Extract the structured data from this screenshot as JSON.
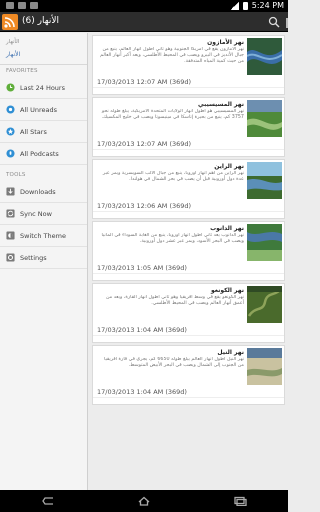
{
  "status_bar": {
    "time": "5:24 PM"
  },
  "action_bar": {
    "title": "الأنهار (6)"
  },
  "sidebar": {
    "feed_section": "الأنهار",
    "feed_label": "الأنهار",
    "favorites_header": "FAVORITES",
    "favorites": [
      {
        "label": "Last 24 Hours",
        "icon": "clock-icon"
      },
      {
        "label": "All Unreads",
        "icon": "unread-icon"
      },
      {
        "label": "All Stars",
        "icon": "star-icon"
      },
      {
        "label": "All Podcasts",
        "icon": "podcast-icon"
      }
    ],
    "tools_header": "TOOLS",
    "tools": [
      {
        "label": "Downloads",
        "icon": "download-icon"
      },
      {
        "label": "Sync Now",
        "icon": "sync-icon"
      },
      {
        "label": "Switch Theme",
        "icon": "theme-icon"
      },
      {
        "label": "Settings",
        "icon": "settings-icon"
      }
    ]
  },
  "articles": [
    {
      "title": "نهر الأمازون",
      "body": "نهر الأمازون يقع في أمريكا الجنوبية وهو ثاني أطول أنهار العالم، ينبع من جبال الأنديز في البيرو ويصب في المحيط الأطلسي، ويعد أكبر أنهار العالم من حيث كمية المياه المتدفقة.",
      "date": "17/03/2013 12:07 AM (369d)",
      "thumb_colors": [
        "#3a6ea8",
        "#7fb0d8",
        "#2f5a3b"
      ]
    },
    {
      "title": "نهر المسيسيبي",
      "body": "نهر المسيسيبي هو أطول أنهار الولايات المتحدة الأمريكية، يبلغ طوله نحو 3757 كم، ينبع من بحيرة إتاسكا في مينيسوتا ويصب في خليج المكسيك.",
      "date": "17/03/2013 12:07 AM (369d)",
      "thumb_colors": [
        "#4f8a3a",
        "#9bc27a",
        "#6d8fb0"
      ]
    },
    {
      "title": "نهر الراين",
      "body": "نهر الراين من أهم أنهار أوروبا، ينبع من جبال الألب السويسرية ويمر عبر عدة دول أوروبية قبل أن يصب في بحر الشمال في هولندا.",
      "date": "17/03/2013 12:06 AM (369d)",
      "thumb_colors": [
        "#5b8fb8",
        "#8fc1de",
        "#3d6b2f"
      ]
    },
    {
      "title": "نهر الدانوب",
      "body": "نهر الدانوب يعد ثاني أطول أنهار أوروبا، ينبع من الغابة السوداء في ألمانيا ويصب في البحر الأسود، ويمر عبر عشر دول أوروبية.",
      "date": "17/03/2013 1:05 AM (369d)",
      "thumb_colors": [
        "#3f7a3c",
        "#87b56b",
        "#4a78a6"
      ]
    },
    {
      "title": "نهر الكونغو",
      "body": "نهر الكونغو يقع في وسط أفريقيا وهو ثاني أطول أنهار القارة، ويعد من أعمق أنهار العالم ويصب في المحيط الأطلسي.",
      "date": "17/03/2013 1:04 AM (369d)",
      "thumb_colors": [
        "#4a6a2c",
        "#8ea35a",
        "#2f4a24"
      ]
    },
    {
      "title": "نهر النيل",
      "body": "نهر النيل أطول أنهار العالم يبلغ طوله 6650 كم، يجري في قارة أفريقيا من الجنوب إلى الشمال ويصب في البحر الأبيض المتوسط.",
      "date": "17/03/2013 1:04 AM (369d)",
      "thumb_colors": [
        "#8a9a6a",
        "#c9c2a0",
        "#5a7a9a"
      ]
    }
  ]
}
